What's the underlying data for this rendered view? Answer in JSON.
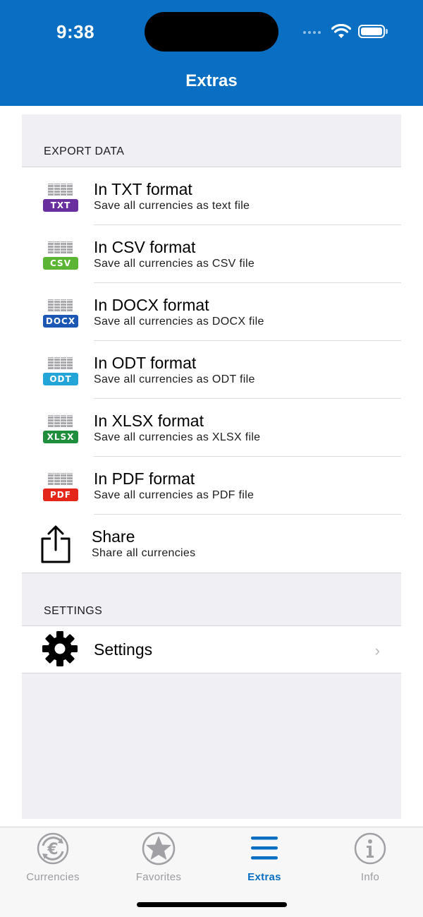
{
  "status_bar": {
    "time": "9:38"
  },
  "header": {
    "title": "Extras"
  },
  "sections": {
    "export": {
      "title": "EXPORT DATA",
      "items": [
        {
          "title": "In TXT format",
          "subtitle": "Save all currencies as text file",
          "badge": "TXT",
          "badge_color": "#6a2f9f"
        },
        {
          "title": "In CSV format",
          "subtitle": "Save all currencies as CSV file",
          "badge": "CSV",
          "badge_color": "#5cb434"
        },
        {
          "title": "In DOCX format",
          "subtitle": "Save all currencies as DOCX file",
          "badge": "DOCX",
          "badge_color": "#1c57b4"
        },
        {
          "title": "In ODT format",
          "subtitle": "Save all currencies as ODT file",
          "badge": "ODT",
          "badge_color": "#24a5d8"
        },
        {
          "title": "In XLSX format",
          "subtitle": "Save all currencies as XLSX file",
          "badge": "XLSX",
          "badge_color": "#1f8e3c"
        },
        {
          "title": "In PDF format",
          "subtitle": "Save all currencies as PDF file",
          "badge": "PDF",
          "badge_color": "#e4261a"
        }
      ],
      "share": {
        "title": "Share",
        "subtitle": "Share all currencies",
        "icon": "share-icon"
      }
    },
    "settings": {
      "title": "SETTINGS",
      "item": {
        "title": "Settings",
        "icon": "gear-icon"
      }
    }
  },
  "tabbar": {
    "items": [
      {
        "label": "Currencies",
        "icon": "euro-exchange-icon",
        "active": false
      },
      {
        "label": "Favorites",
        "icon": "star-icon",
        "active": false
      },
      {
        "label": "Extras",
        "icon": "menu-icon",
        "active": true
      },
      {
        "label": "Info",
        "icon": "info-icon",
        "active": false
      }
    ]
  },
  "colors": {
    "accent": "#0a6fc2",
    "background": "#efeff4"
  }
}
